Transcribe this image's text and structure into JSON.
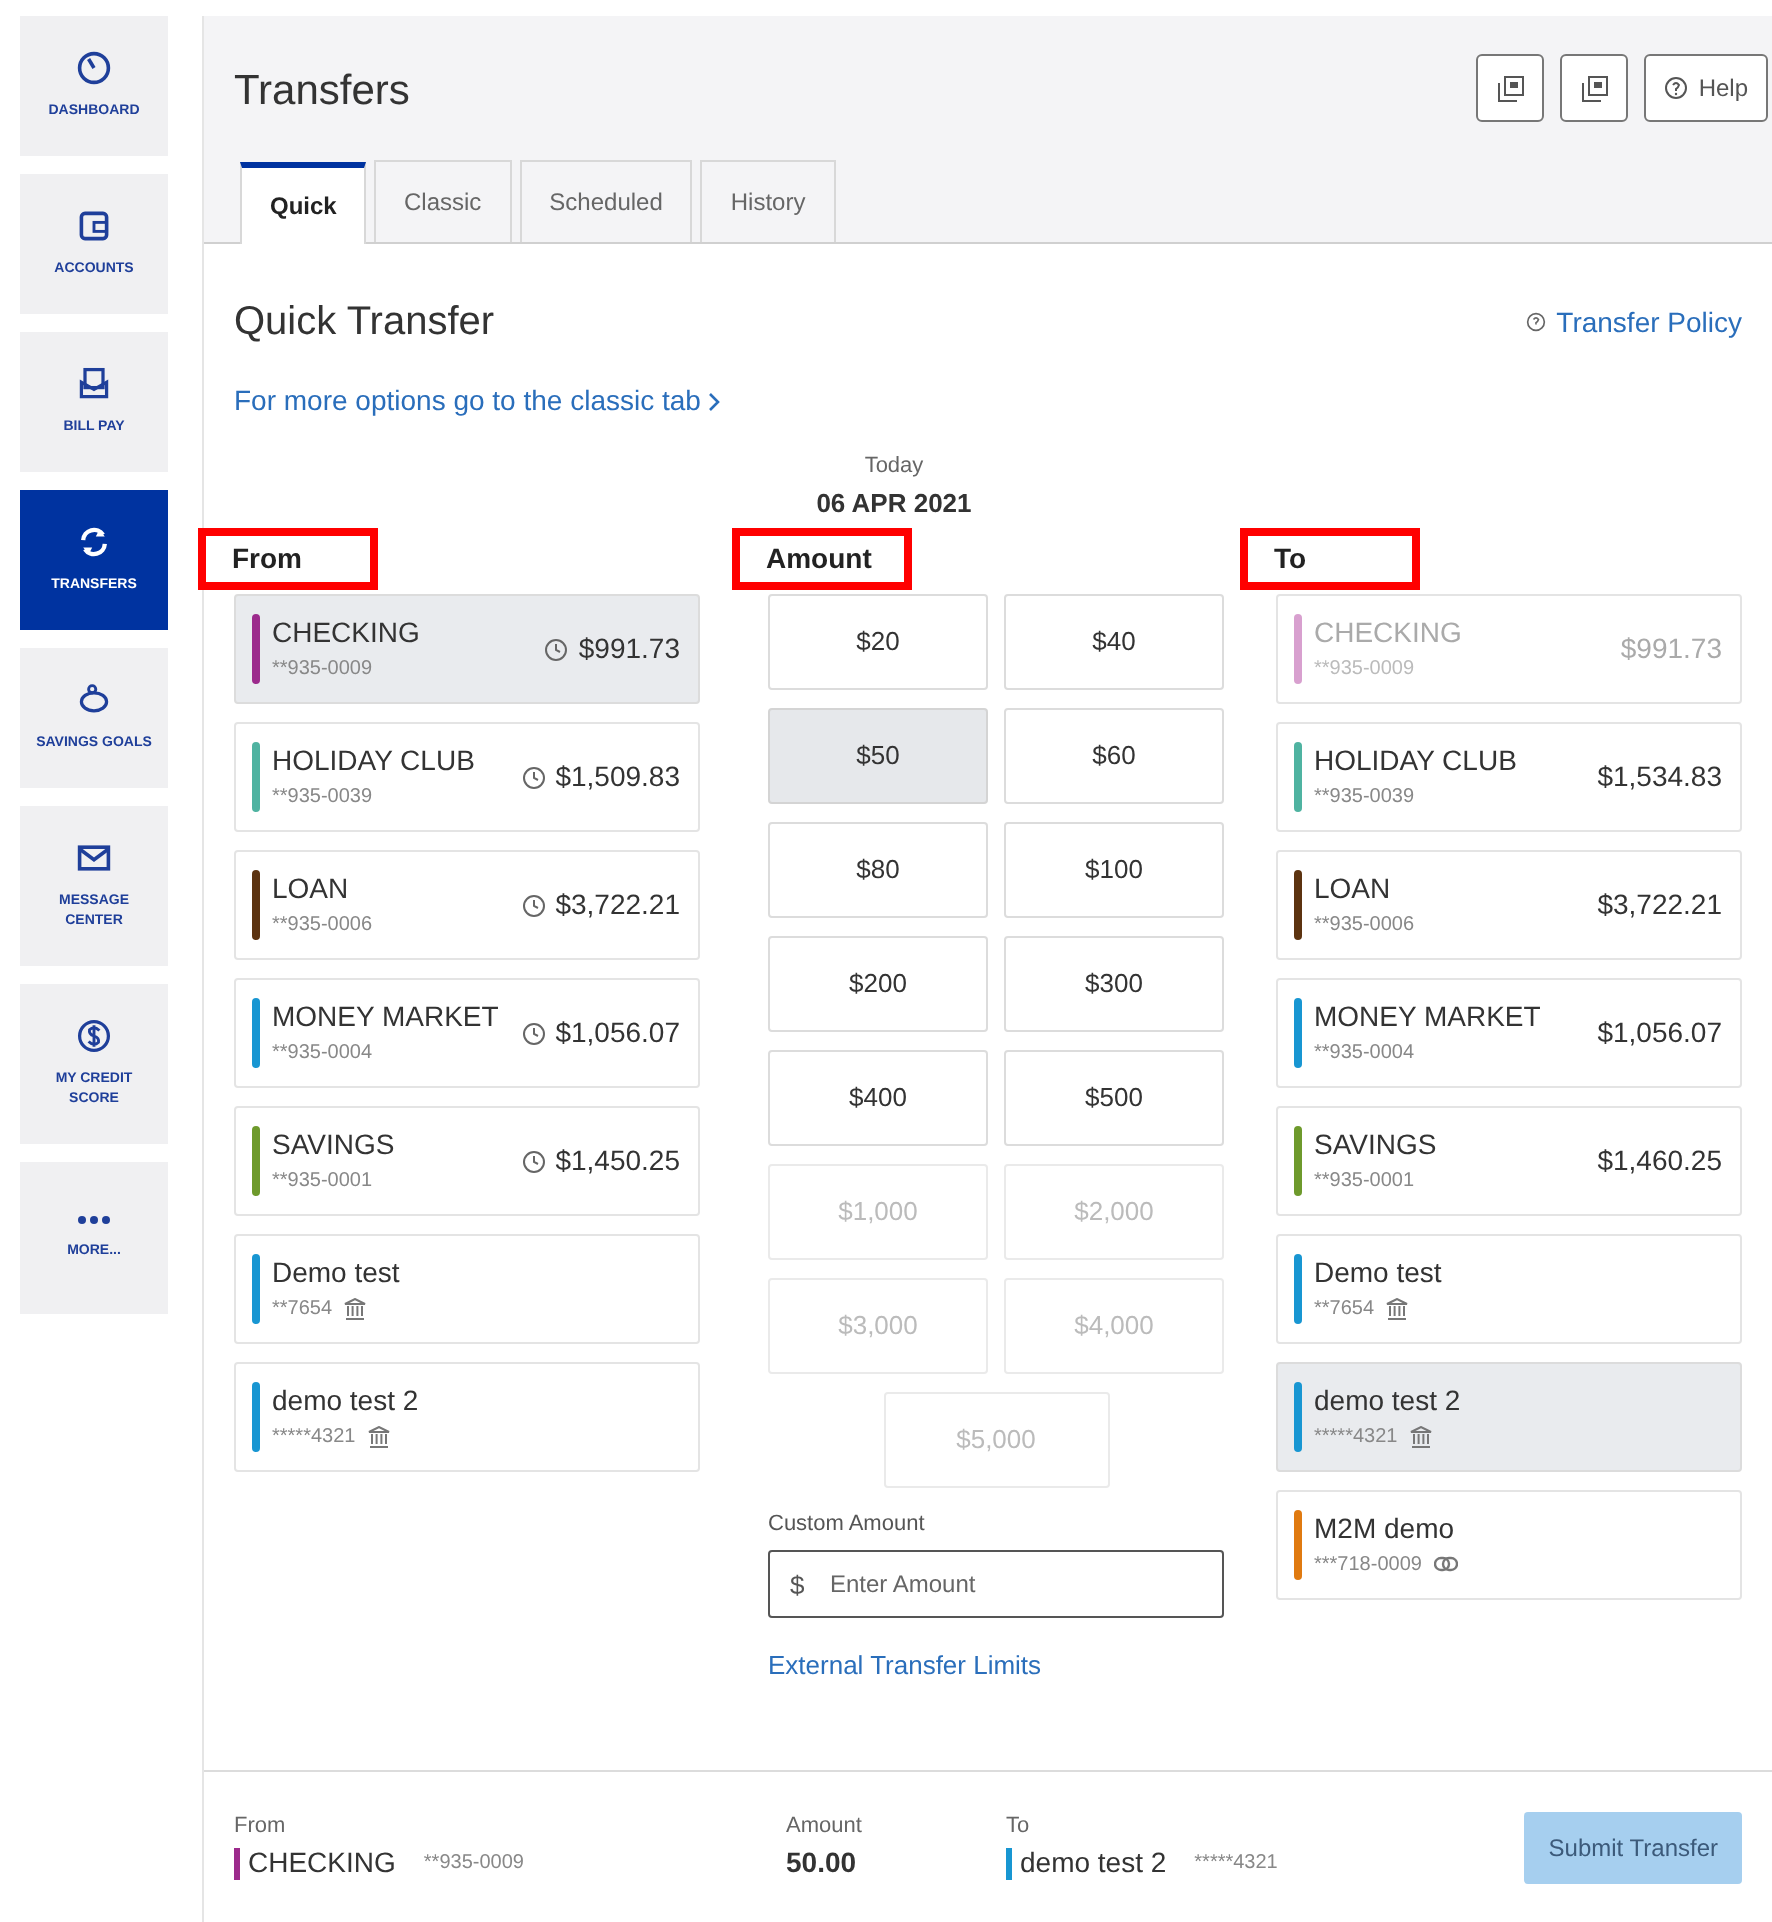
{
  "sidebar": {
    "items": [
      {
        "label": "DASHBOARD",
        "selected": false
      },
      {
        "label": "ACCOUNTS",
        "selected": false
      },
      {
        "label": "BILL PAY",
        "selected": false
      },
      {
        "label": "TRANSFERS",
        "selected": true
      },
      {
        "label": "SAVINGS GOALS",
        "selected": false
      },
      {
        "label": "MESSAGE CENTER",
        "selected": false
      },
      {
        "label": "MY CREDIT SCORE",
        "selected": false
      },
      {
        "label": "MORE...",
        "selected": false
      }
    ]
  },
  "header": {
    "title": "Transfers",
    "tools": [
      {
        "kind": "icon"
      },
      {
        "kind": "icon"
      },
      {
        "kind": "help",
        "label": "Help"
      }
    ]
  },
  "tabs": [
    {
      "label": "Quick",
      "selected": true
    },
    {
      "label": "Classic",
      "selected": false
    },
    {
      "label": "Scheduled",
      "selected": false
    },
    {
      "label": "History",
      "selected": false
    }
  ],
  "quick": {
    "title": "Quick Transfer",
    "policy_link": "Transfer Policy",
    "classic_link": "For more options go to the classic tab",
    "date_caption": "Today",
    "date": "06 APR 2021"
  },
  "from": {
    "heading": "From",
    "highlighted": true,
    "accounts": [
      {
        "name": "CHECKING",
        "number": "**935-0009",
        "balance": "$991.73",
        "color": "#9c2a8c",
        "kind": "internal",
        "selected": true,
        "disabled": false
      },
      {
        "name": "HOLIDAY CLUB",
        "number": "**935-0039",
        "balance": "$1,509.83",
        "color": "#4fb3a1",
        "kind": "internal",
        "selected": false,
        "disabled": false
      },
      {
        "name": "LOAN",
        "number": "**935-0006",
        "balance": "$3,722.21",
        "color": "#5c3310",
        "kind": "internal",
        "selected": false,
        "disabled": false
      },
      {
        "name": "MONEY MARKET",
        "number": "**935-0004",
        "balance": "$1,056.07",
        "color": "#1896d2",
        "kind": "internal",
        "selected": false,
        "disabled": false
      },
      {
        "name": "SAVINGS",
        "number": "**935-0001",
        "balance": "$1,450.25",
        "color": "#6e9a2c",
        "kind": "internal",
        "selected": false,
        "disabled": false
      },
      {
        "name": "Demo test",
        "number": "**7654",
        "color": "#1896d2",
        "kind": "external",
        "selected": false,
        "disabled": false
      },
      {
        "name": "demo test 2",
        "number": "*****4321",
        "color": "#1896d2",
        "kind": "external",
        "selected": false,
        "disabled": false
      }
    ]
  },
  "amount": {
    "heading": "Amount",
    "highlighted": true,
    "presets": [
      {
        "label": "$20",
        "selected": false,
        "disabled": false
      },
      {
        "label": "$40",
        "selected": false,
        "disabled": false
      },
      {
        "label": "$50",
        "selected": true,
        "disabled": false
      },
      {
        "label": "$60",
        "selected": false,
        "disabled": false
      },
      {
        "label": "$80",
        "selected": false,
        "disabled": false
      },
      {
        "label": "$100",
        "selected": false,
        "disabled": false
      },
      {
        "label": "$200",
        "selected": false,
        "disabled": false
      },
      {
        "label": "$300",
        "selected": false,
        "disabled": false
      },
      {
        "label": "$400",
        "selected": false,
        "disabled": false
      },
      {
        "label": "$500",
        "selected": false,
        "disabled": false
      },
      {
        "label": "$1,000",
        "selected": false,
        "disabled": true
      },
      {
        "label": "$2,000",
        "selected": false,
        "disabled": true
      },
      {
        "label": "$3,000",
        "selected": false,
        "disabled": true
      },
      {
        "label": "$4,000",
        "selected": false,
        "disabled": true
      },
      {
        "label": "$5,000",
        "selected": false,
        "disabled": true
      }
    ],
    "custom_label": "Custom Amount",
    "currency": "$",
    "placeholder": "Enter Amount",
    "limits_link": "External Transfer Limits"
  },
  "to": {
    "heading": "To",
    "highlighted": true,
    "accounts": [
      {
        "name": "CHECKING",
        "number": "**935-0009",
        "balance": "$991.73",
        "color": "#d8a0cf",
        "kind": "internal",
        "selected": false,
        "disabled": true
      },
      {
        "name": "HOLIDAY CLUB",
        "number": "**935-0039",
        "balance": "$1,534.83",
        "color": "#4fb3a1",
        "kind": "internal",
        "selected": false,
        "disabled": false
      },
      {
        "name": "LOAN",
        "number": "**935-0006",
        "balance": "$3,722.21",
        "color": "#5c3310",
        "kind": "internal",
        "selected": false,
        "disabled": false
      },
      {
        "name": "MONEY MARKET",
        "number": "**935-0004",
        "balance": "$1,056.07",
        "color": "#1896d2",
        "kind": "internal",
        "selected": false,
        "disabled": false
      },
      {
        "name": "SAVINGS",
        "number": "**935-0001",
        "balance": "$1,460.25",
        "color": "#6e9a2c",
        "kind": "internal",
        "selected": false,
        "disabled": false
      },
      {
        "name": "Demo test",
        "number": "**7654",
        "color": "#1896d2",
        "kind": "external",
        "selected": false,
        "disabled": false
      },
      {
        "name": "demo test 2",
        "number": "*****4321",
        "color": "#1896d2",
        "kind": "external",
        "selected": true,
        "disabled": false
      },
      {
        "name": "M2M demo",
        "number": "***718-0009",
        "color": "#e07a10",
        "kind": "linked",
        "selected": false,
        "disabled": false
      }
    ]
  },
  "summary": {
    "from": {
      "label": "From",
      "name": "CHECKING",
      "number": "**935-0009",
      "color": "#9c2a8c"
    },
    "amount_label": "Amount",
    "amount": "50.00",
    "to": {
      "label": "To",
      "name": "demo test 2",
      "number": "*****4321",
      "color": "#1896d2"
    },
    "submit": "Submit Transfer",
    "submit_disabled": true
  }
}
